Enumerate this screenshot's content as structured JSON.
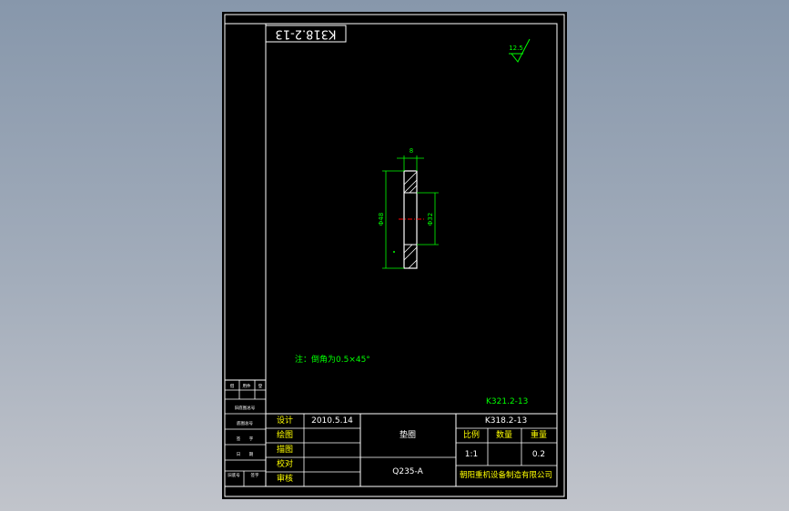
{
  "drawing": {
    "header_code": "K318.2-13",
    "chamfer_note": "注：倒角为0.5×45°",
    "ref_code": "K321.2-13",
    "surface_finish": "12.5",
    "dims": {
      "thickness": "8",
      "outer": "Φ48",
      "inner": "Φ32"
    }
  },
  "title_block": {
    "design_label": "设计",
    "design_date": "2010.5.14",
    "draw_label": "绘图",
    "trace_label": "描图",
    "check_label": "校对",
    "review_label": "审核",
    "part_name": "垫圈",
    "material": "Q235-A",
    "drawing_number": "K318.2-13",
    "scale_label": "比例",
    "quantity_label": "数量",
    "weight_label": "重量",
    "scale_value": "1:1",
    "weight_value": "0.2",
    "company": "朝阳重机设备制造有限公司"
  },
  "side_stub": {
    "r1a": "借",
    "r1b": "用件",
    "r1c": "登",
    "r2a": "旧底图总号",
    "r3a": "底图总号",
    "r4a": "签",
    "r4b": "字",
    "r5a": "日",
    "r5b": "期",
    "r6a": "旧底号",
    "r6b": "签字"
  },
  "colors": {
    "sheet": "#000000",
    "frame": "#ffffff",
    "dimension": "#00ff00",
    "title_text": "#ffff00",
    "center_line": "#ff0000"
  }
}
